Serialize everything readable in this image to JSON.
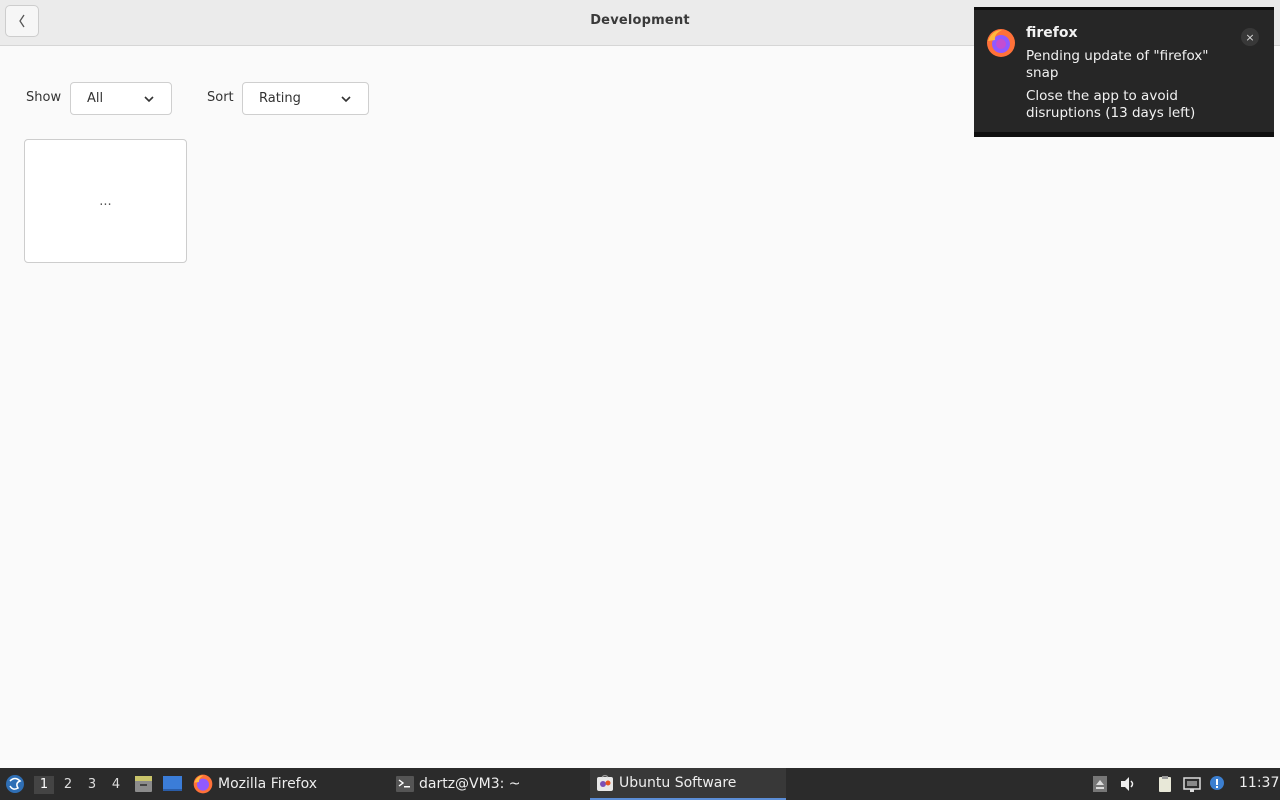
{
  "header": {
    "title": "Development",
    "back_icon": "chevron-left-icon"
  },
  "filters": {
    "show_label": "Show",
    "show_value": "All",
    "sort_label": "Sort",
    "sort_value": "Rating"
  },
  "app_tile": {
    "placeholder": "..."
  },
  "notification": {
    "app_name": "firefox",
    "icon": "firefox-icon",
    "summary": "Pending update of \"firefox\" snap",
    "body": "Close the app to avoid disruptions (13 days left)",
    "close_symbol": "×"
  },
  "taskbar": {
    "workspaces": [
      "1",
      "2",
      "3",
      "4"
    ],
    "tasks": [
      {
        "label": "Mozilla Firefox",
        "icon": "firefox-icon"
      },
      {
        "label": "dartz@VM3: ~",
        "icon": "terminal-icon"
      },
      {
        "label": "Ubuntu Software",
        "icon": "software-center-icon"
      }
    ],
    "clock": "11:37"
  },
  "colors": {
    "taskbar_bg": "#2b2b2b",
    "accent": "#5b8dd6",
    "notification_bg": "#262626"
  }
}
